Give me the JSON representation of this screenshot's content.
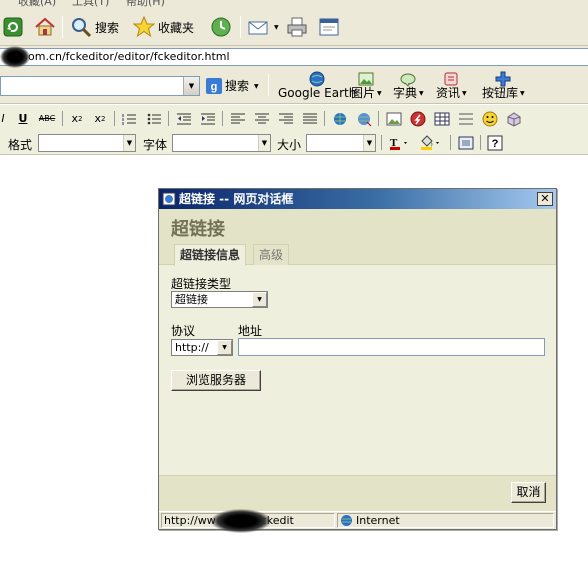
{
  "menubar": {
    "items": [
      "收藏(A)",
      "工具(T)",
      "帮助(H)"
    ]
  },
  "std_toolbar": {
    "search_label": "搜索",
    "favorites_label": "收藏夹"
  },
  "address": {
    "url": "om.cn/fckeditor/editor/fckeditor.html"
  },
  "google_bar": {
    "search_label": "搜索",
    "earth_label": "Google Earth",
    "images_label": "图片",
    "dict_label": "字典",
    "news_label": "资讯",
    "buttons_label": "按钮库"
  },
  "fck_toolbar": {
    "format_label": "格式",
    "font_label": "字体",
    "size_label": "大小"
  },
  "dialog": {
    "title": "超链接 -- 网页对话框",
    "heading": "超链接",
    "tabs": [
      {
        "label": "超链接信息",
        "active": true
      },
      {
        "label": "高级",
        "active": false
      }
    ],
    "link_type_label": "超链接类型",
    "link_type_value": "超链接",
    "protocol_label": "协议",
    "protocol_value": "http://",
    "url_label": "地址",
    "url_value": "",
    "browse_button": "浏览服务器",
    "cancel_button": "取消",
    "status_url": "http://ww                    om.cn/fckedit",
    "status_zone": "Internet",
    "close_glyph": "✕"
  },
  "colors": {
    "title_start": "#0a246a",
    "title_end": "#a6caf0",
    "dialog_bg": "#efefde",
    "dialog_header_bg": "#e3e3c7",
    "heading_color": "#737357"
  }
}
